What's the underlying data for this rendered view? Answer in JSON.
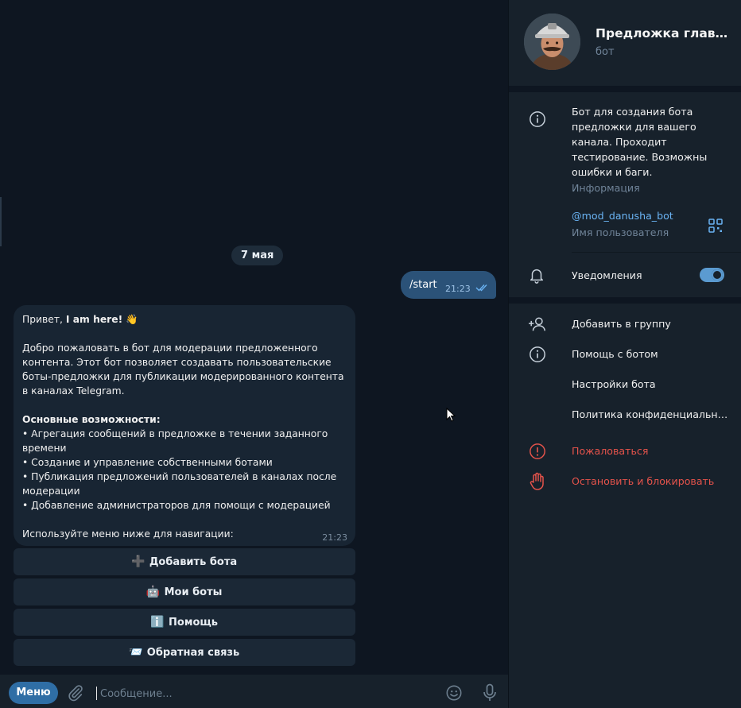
{
  "chat": {
    "date": "7 мая",
    "outgoing": {
      "text": "/start",
      "time": "21:23"
    },
    "incoming": {
      "greeting_prefix": "Привет, ",
      "greeting_bold": "I am here!",
      "greeting_emoji": "👋",
      "intro": "Добро пожаловать в бот для модерации предложенного контента. Этот бот позволяет создавать пользовательские боты-предложки для публикации модерированного контента в каналах Telegram.",
      "features_title": "Основные возможности:",
      "features": [
        "• Агрегация сообщений в предложке в течении заданного времени",
        "• Создание и управление собственными ботами",
        "• Публикация предложений пользователей в каналах после модерации",
        "• Добавление администраторов для помощи с модерацией"
      ],
      "footer": "Используйте меню ниже для навигации:",
      "time": "21:23"
    },
    "keyboard": [
      {
        "icon": "➕",
        "label": "Добавить бота"
      },
      {
        "icon": "🤖",
        "label": "Мои боты"
      },
      {
        "icon": "ℹ️",
        "label": "Помощь"
      },
      {
        "icon": "📨",
        "label": "Обратная связь"
      }
    ],
    "composer": {
      "menu_label": "Меню",
      "placeholder": "Сообщение..."
    }
  },
  "profile": {
    "name": "Предложка главн...",
    "subtitle": "бот",
    "description": "Бот для создания бота предложки для вашего канала. Проходит тестирование. Возможны ошибки и баги.",
    "description_caption": "Информация",
    "username": "@mod_danusha_bot",
    "username_caption": "Имя пользователя",
    "notifications_label": "Уведомления",
    "notifications_on": true,
    "actions": [
      {
        "icon": "add-user-icon",
        "label": "Добавить в группу"
      },
      {
        "icon": "info-icon",
        "label": "Помощь с ботом"
      },
      {
        "icon": "",
        "label": "Настройки бота"
      },
      {
        "icon": "",
        "label": "Политика конфиденциальност..."
      }
    ],
    "danger_actions": [
      {
        "icon": "warning-icon",
        "label": "Пожаловаться"
      },
      {
        "icon": "hand-stop-icon",
        "label": "Остановить и блокировать"
      }
    ]
  },
  "colors": {
    "accent": "#2f6ea5",
    "outgoing_bubble": "#2b5278",
    "incoming_bubble": "#182533",
    "danger": "#e5534b",
    "link": "#6ab3f3"
  }
}
